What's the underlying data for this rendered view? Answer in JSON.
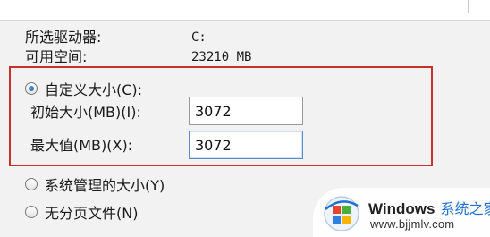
{
  "drive_info": {
    "selected_drive_label": "所选驱动器:",
    "selected_drive_value": "C:",
    "available_space_label": "可用空间:",
    "available_space_value": "23210 MB"
  },
  "paging_options": {
    "custom_size_label": "自定义大小(C):",
    "initial_size_label": "初始大小(MB)(I):",
    "initial_size_value": "3072",
    "max_size_label": "最大值(MB)(X):",
    "max_size_value": "3072",
    "system_managed_label": "系统管理的大小(Y)",
    "no_paging_label": "无分页文件(N)",
    "selected": "custom"
  },
  "watermark": {
    "brand": "Windows",
    "site_name": "系统之家",
    "url": "www.bjjmlv.com",
    "logo_icon": "windows-logo-icon"
  },
  "colors": {
    "highlight_border": "#c9312f",
    "radio_dot": "#1b57a8",
    "watermark_text": "#1e6fd1"
  }
}
